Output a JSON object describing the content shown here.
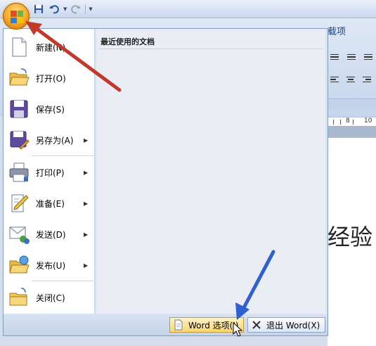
{
  "ribbon": {
    "tab_partial": "载项"
  },
  "ruler": {
    "numbers": [
      "8",
      "10"
    ]
  },
  "document": {
    "visible_text": "经验"
  },
  "menu": {
    "items": [
      {
        "label": "新建(N)",
        "icon": "new-document-icon",
        "has_submenu": false
      },
      {
        "label": "打开(O)",
        "icon": "open-folder-icon",
        "has_submenu": false
      },
      {
        "label": "保存(S)",
        "icon": "save-disk-icon",
        "has_submenu": false
      },
      {
        "label": "另存为(A)",
        "icon": "save-as-icon",
        "has_submenu": true
      },
      {
        "label": "打印(P)",
        "icon": "printer-icon",
        "has_submenu": true
      },
      {
        "label": "准备(E)",
        "icon": "prepare-document-icon",
        "has_submenu": true
      },
      {
        "label": "发送(D)",
        "icon": "send-icon",
        "has_submenu": true
      },
      {
        "label": "发布(U)",
        "icon": "publish-icon",
        "has_submenu": true
      },
      {
        "label": "关闭(C)",
        "icon": "close-folder-icon",
        "has_submenu": false
      }
    ],
    "recent_title": "最近使用的文档",
    "footer": {
      "options_label": "Word 选项(I)",
      "exit_label": "退出 Word(X)"
    }
  },
  "colors": {
    "office_button": "#f6a623",
    "menu_border": "#7f9db9",
    "annotation_red": "#c0392b",
    "annotation_blue": "#2f5fd0",
    "hover_button": "#fcd66e"
  }
}
